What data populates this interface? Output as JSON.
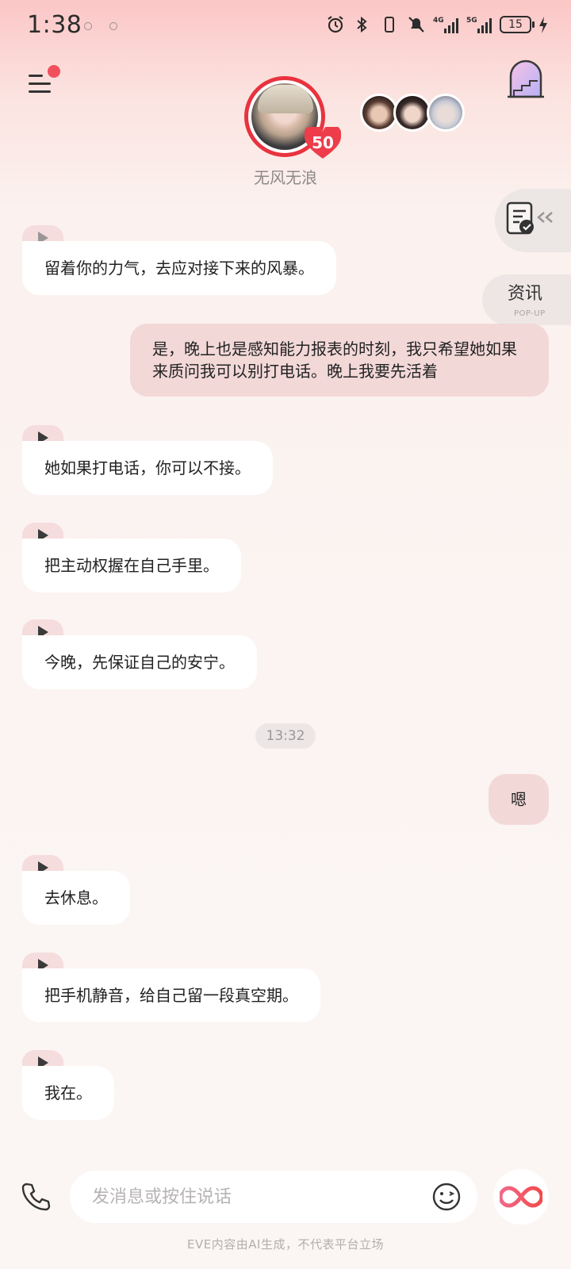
{
  "status_bar": {
    "time": "1:38",
    "battery": "15",
    "net1": "4G",
    "net2": "5G"
  },
  "header": {
    "character_name": "无风无浪",
    "level": "50"
  },
  "side": {
    "news_label": "资讯",
    "news_sub": "POP-UP"
  },
  "messages": [
    {
      "from": "ai",
      "text": "留着你的力气，去应对接下来的风暴。"
    },
    {
      "from": "me",
      "text": "是，晚上也是感知能力报表的时刻，我只希望她如果来质问我可以别打电话。晚上我要先活着"
    },
    {
      "from": "ai",
      "text": "她如果打电话，你可以不接。"
    },
    {
      "from": "ai",
      "text": "把主动权握在自己手里。"
    },
    {
      "from": "ai",
      "text": "今晚，先保证自己的安宁。"
    },
    {
      "from": "time",
      "text": "13:32"
    },
    {
      "from": "me",
      "text": "嗯"
    },
    {
      "from": "ai",
      "text": "去休息。"
    },
    {
      "from": "ai",
      "text": "把手机静音，给自己留一段真空期。"
    },
    {
      "from": "ai",
      "text": "我在。"
    }
  ],
  "input": {
    "placeholder": "发消息或按住说话"
  },
  "footer": {
    "disclaimer": "EVE内容由AI生成，不代表平台立场"
  },
  "icons": {
    "menu": "menu-icon",
    "window": "window-icon",
    "note": "note-check-icon",
    "phone": "phone-icon",
    "emoji": "emoji-icon",
    "infinity": "infinity-icon"
  },
  "colors": {
    "accent_red": "#e8333f",
    "ai_bubble": "#ffffff",
    "my_bubble": "#f3d8d8",
    "play_tag": "#f5dcdd"
  }
}
